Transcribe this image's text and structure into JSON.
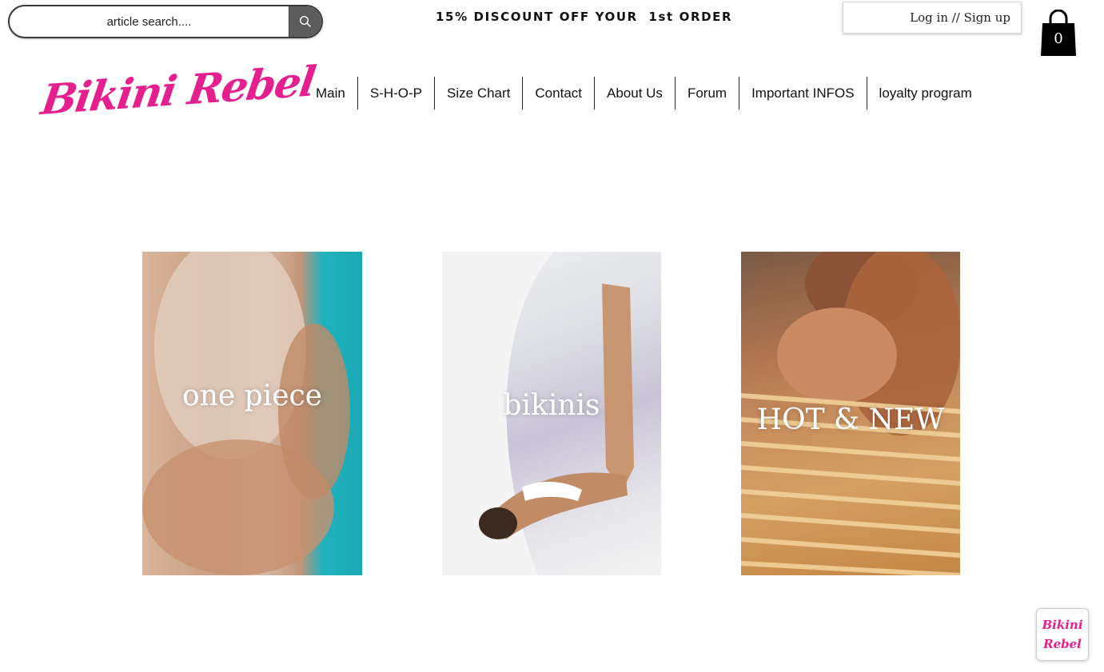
{
  "search": {
    "placeholder": "article search...."
  },
  "promo": {
    "text": "15% DISCOUNT OFF YOUR  1st ORDER"
  },
  "account": {
    "login_label": "Log in // Sign up"
  },
  "cart": {
    "count": "0"
  },
  "brand": {
    "logo_text": "Bikini Rebel",
    "badge_line1": "Bikini",
    "badge_line2": "Rebel",
    "color": "#e4208f"
  },
  "nav": {
    "items": [
      {
        "label": "Main"
      },
      {
        "label": "S-H-O-P"
      },
      {
        "label": "Size Chart"
      },
      {
        "label": "Contact"
      },
      {
        "label": "About Us"
      },
      {
        "label": "Forum"
      },
      {
        "label": "Important INFOS"
      },
      {
        "label": "loyalty program"
      }
    ]
  },
  "categories": [
    {
      "label": "one piece"
    },
    {
      "label": "bikinis"
    },
    {
      "label": "HOT & NEW"
    }
  ],
  "icons": {
    "search": "search-icon",
    "cart": "shopping-bag-icon"
  }
}
